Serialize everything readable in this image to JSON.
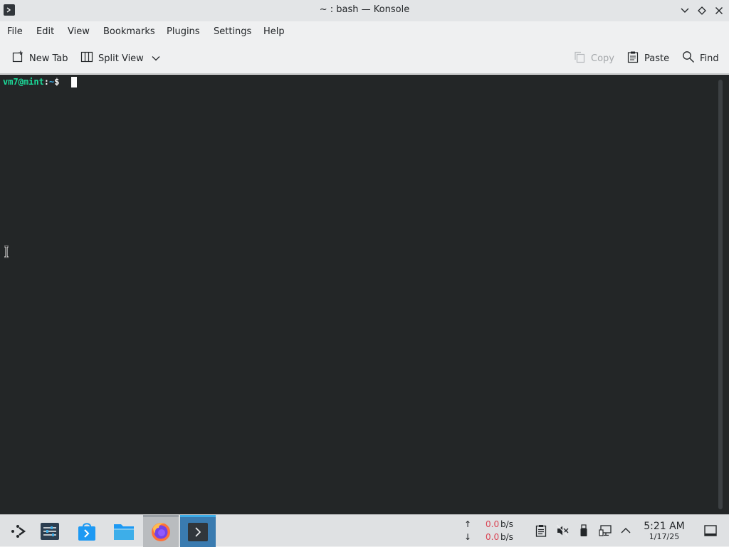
{
  "window": {
    "title": "~ : bash — Konsole",
    "app_icon": "terminal-icon",
    "controls": [
      "minimize-icon",
      "maximize-icon",
      "close-icon"
    ]
  },
  "menubar": {
    "items": [
      "File",
      "Edit",
      "View",
      "Bookmarks",
      "Plugins",
      "Settings",
      "Help"
    ]
  },
  "toolbar": {
    "new_tab": "New Tab",
    "split_view": "Split View",
    "copy": "Copy",
    "paste": "Paste",
    "find": "Find"
  },
  "terminal": {
    "user_host": "vm7@mint",
    "colon": ":",
    "path": "~",
    "dollar": "$",
    "colors": {
      "background": "#232627",
      "user": "#1cdc9a",
      "path": "#3daee9",
      "text": "#fcfcfc"
    }
  },
  "taskbar": {
    "apps": [
      "application-launcher-icon",
      "system-settings-icon",
      "discover-store-icon",
      "file-manager-icon",
      "firefox-icon",
      "konsole-icon"
    ],
    "net_up": {
      "arrow": "↑",
      "value": "0.0",
      "unit": "b/s"
    },
    "net_down": {
      "arrow": "↓",
      "value": "0.0",
      "unit": "b/s"
    },
    "tray": [
      "clipboard-icon",
      "volume-muted-icon",
      "removable-device-icon",
      "network-wired-icon",
      "tray-expand-icon"
    ],
    "clock_time": "5:21 AM",
    "clock_date": "1/17/25",
    "show_desktop": "show-desktop-icon"
  }
}
